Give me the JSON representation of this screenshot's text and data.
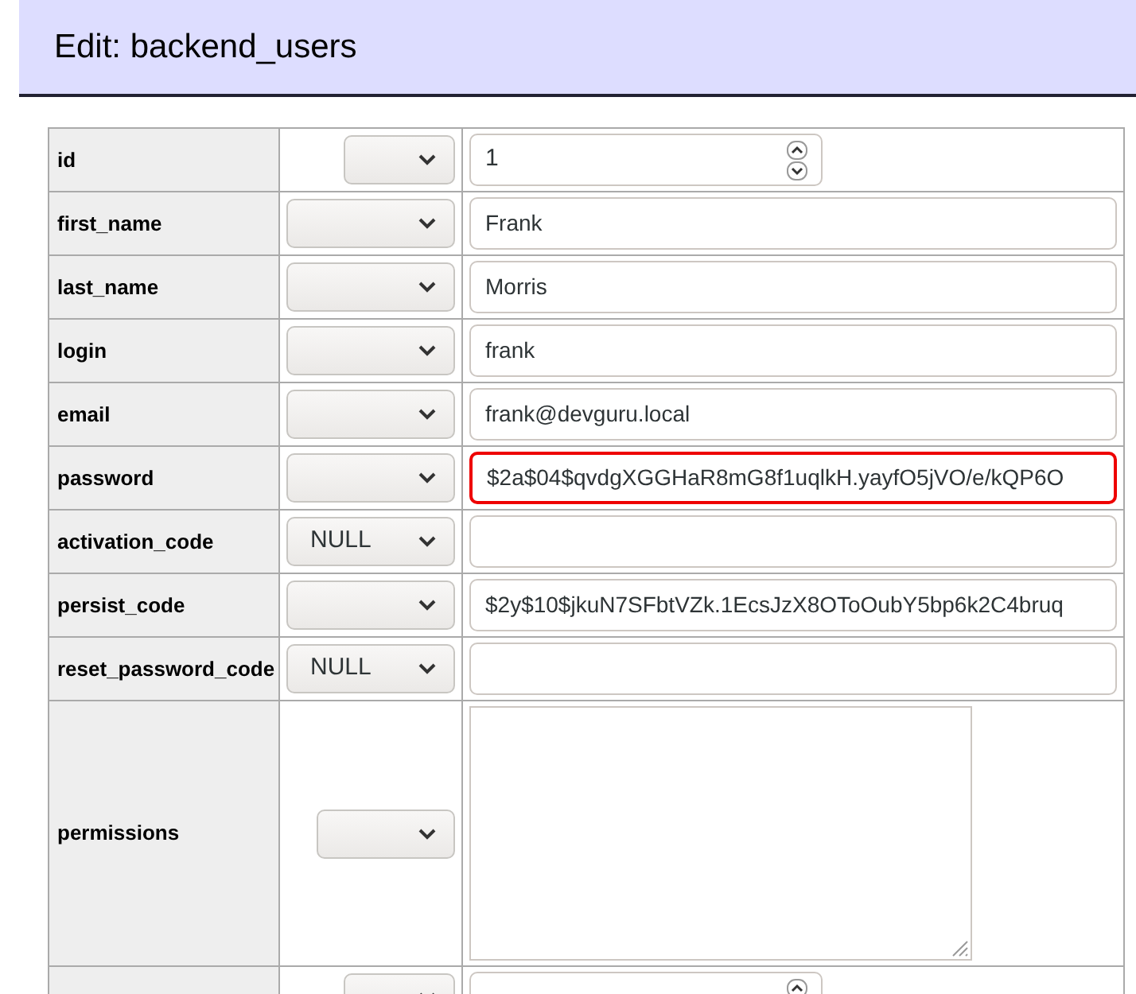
{
  "title": "Edit: backend_users",
  "rows": [
    {
      "name": "id",
      "kind": "number",
      "function": "",
      "value": "1",
      "highlighted": false
    },
    {
      "name": "first_name",
      "kind": "text",
      "function": "",
      "value": "Frank",
      "highlighted": false
    },
    {
      "name": "last_name",
      "kind": "text",
      "function": "",
      "value": "Morris",
      "highlighted": false
    },
    {
      "name": "login",
      "kind": "text",
      "function": "",
      "value": "frank",
      "highlighted": false
    },
    {
      "name": "email",
      "kind": "text",
      "function": "",
      "value": "frank@devguru.local",
      "highlighted": false
    },
    {
      "name": "password",
      "kind": "text",
      "function": "",
      "value": "$2a$04$qvdgXGGHaR8mG8f1uqlkH.yayfO5jVO/e/kQP6O",
      "highlighted": true
    },
    {
      "name": "activation_code",
      "kind": "text",
      "function": "NULL",
      "value": "",
      "highlighted": false
    },
    {
      "name": "persist_code",
      "kind": "text",
      "function": "",
      "value": "$2y$10$jkuN7SFbtVZk.1EcsJzX8OToOubY5bp6k2C4bruq",
      "highlighted": false
    },
    {
      "name": "reset_password_code",
      "kind": "text",
      "function": "NULL",
      "value": "",
      "highlighted": false
    },
    {
      "name": "permissions",
      "kind": "textarea",
      "function": "",
      "value": "",
      "highlighted": false
    },
    {
      "kind": "number",
      "function": "",
      "value": "",
      "highlighted": false
    }
  ]
}
